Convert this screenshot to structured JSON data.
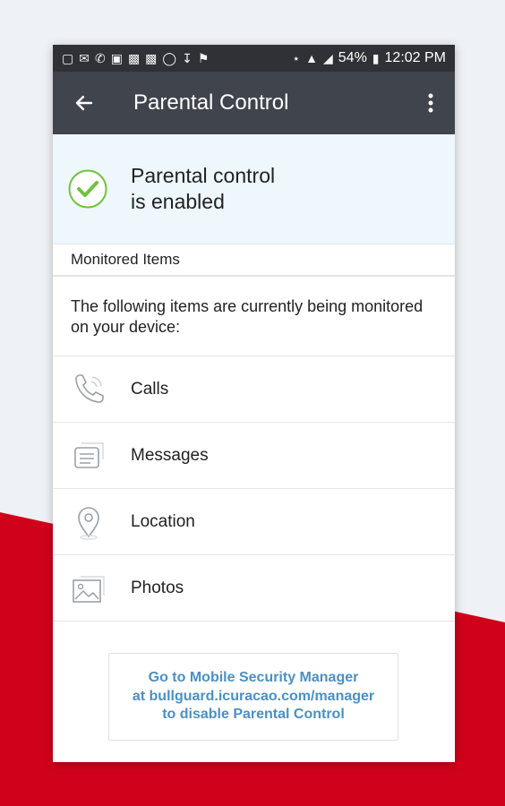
{
  "colors": {
    "accent_red": "#d0021b",
    "appbar": "#40444c",
    "statusbar": "#2f3136",
    "check_green": "#6fc23d",
    "link_blue": "#4a90c6"
  },
  "statusbar": {
    "battery": "54%",
    "time": "12:02 PM"
  },
  "appbar": {
    "title": "Parental Control",
    "back_icon": "arrow-left-icon",
    "menu_icon": "more-vertical-icon"
  },
  "status": {
    "text": "Parental control\nis enabled",
    "icon": "check-circle-icon"
  },
  "section": {
    "header": "Monitored Items",
    "description": "The following items are currently being monitored on your device:"
  },
  "items": [
    {
      "label": "Calls",
      "icon": "phone-icon"
    },
    {
      "label": "Messages",
      "icon": "message-icon"
    },
    {
      "label": "Location",
      "icon": "location-pin-icon"
    },
    {
      "label": "Photos",
      "icon": "photo-icon"
    }
  ],
  "disable_message": "Go to Mobile Security Manager\nat bullguard.icuracao.com/manager\nto disable Parental Control"
}
